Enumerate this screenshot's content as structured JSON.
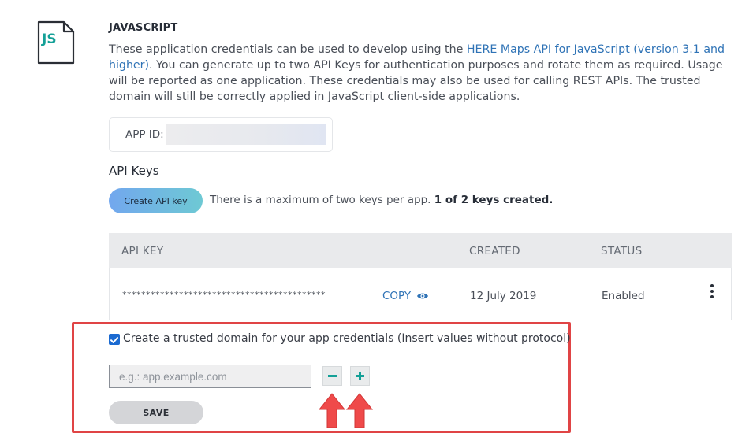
{
  "section": {
    "icon_label": "JS",
    "title": "JAVASCRIPT",
    "description_pre": "These application credentials can be used to develop using the ",
    "description_link": "HERE Maps API for JavaScript (version 3.1 and higher)",
    "description_post": ". You can generate up to two API Keys for authentication purposes and rotate them as required. Usage will be reported as one application. These credentials may also be used for calling REST APIs. The trusted domain will still be correctly applied in JavaScript client-side applications."
  },
  "app_id": {
    "label": "APP ID:"
  },
  "api_keys": {
    "title": "API Keys",
    "create_label": "Create API key",
    "limit_text": "There is a maximum of two keys per app. ",
    "count_text": "1 of 2 keys created.",
    "columns": {
      "key": "API KEY",
      "created": "CREATED",
      "status": "STATUS"
    },
    "row": {
      "masked_key": "*******************************************",
      "copy_label": "COPY",
      "created": "12 July 2019",
      "status": "Enabled"
    }
  },
  "trusted_domain": {
    "checked": true,
    "checkbox_label": "Create a trusted domain for your app credentials (Insert values without protocol)",
    "input_placeholder": "e.g.: app.example.com",
    "input_value": "",
    "save_label": "SAVE"
  },
  "colors": {
    "accent_blue": "#1b6ad1",
    "teal": "#14a097",
    "highlight_red": "#e04445",
    "arrow_red": "#ef4a4a"
  },
  "icons": [
    "js-file-icon",
    "eye-icon",
    "more-vertical-icon",
    "minus-icon",
    "plus-icon",
    "arrow-up-icon",
    "checkbox-checked-icon"
  ]
}
